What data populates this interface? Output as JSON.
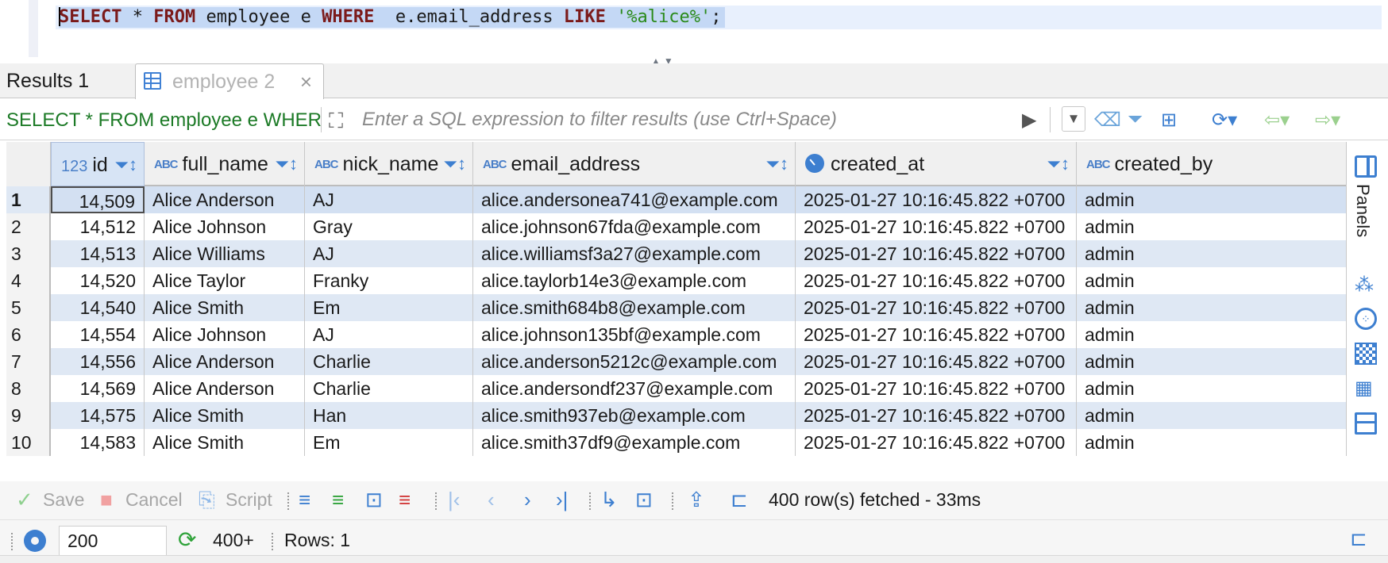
{
  "editor": {
    "sql_parts": [
      {
        "t": "SELECT",
        "c": "kw"
      },
      {
        "t": " * ",
        "c": "id"
      },
      {
        "t": "FROM",
        "c": "kw"
      },
      {
        "t": " employee e ",
        "c": "id"
      },
      {
        "t": "WHERE",
        "c": "kw"
      },
      {
        "t": "  e.email_address ",
        "c": "id"
      },
      {
        "t": "LIKE",
        "c": "kw"
      },
      {
        "t": " ",
        "c": "id"
      },
      {
        "t": "'%alice%'",
        "c": "str"
      },
      {
        "t": ";",
        "c": "id"
      }
    ],
    "splitter_arrows": "▲▼"
  },
  "tabs": {
    "results_label": "Results 1",
    "employee_label": "employee 2",
    "close_glyph": "×"
  },
  "filter": {
    "query_text": "SELECT * FROM employee e WHERE  e.email_address LIKE '%alice%'",
    "placeholder": "Enter a SQL expression to filter results (use Ctrl+Space)"
  },
  "grid": {
    "columns": [
      {
        "label": "id",
        "type": "123"
      },
      {
        "label": "full_name",
        "type": "ABC"
      },
      {
        "label": "nick_name",
        "type": "ABC"
      },
      {
        "label": "email_address",
        "type": "ABC"
      },
      {
        "label": "created_at",
        "type": "clock"
      },
      {
        "label": "created_by",
        "type": "ABC"
      }
    ],
    "rows": [
      [
        "1",
        "14,509",
        "Alice Anderson",
        "AJ",
        "alice.andersonea741@example.com",
        "2025-01-27 10:16:45.822 +0700",
        "admin"
      ],
      [
        "2",
        "14,512",
        "Alice Johnson",
        "Gray",
        "alice.johnson67fda@example.com",
        "2025-01-27 10:16:45.822 +0700",
        "admin"
      ],
      [
        "3",
        "14,513",
        "Alice Williams",
        "AJ",
        "alice.williamsf3a27@example.com",
        "2025-01-27 10:16:45.822 +0700",
        "admin"
      ],
      [
        "4",
        "14,520",
        "Alice Taylor",
        "Franky",
        "alice.taylorb14e3@example.com",
        "2025-01-27 10:16:45.822 +0700",
        "admin"
      ],
      [
        "5",
        "14,540",
        "Alice Smith",
        "Em",
        "alice.smith684b8@example.com",
        "2025-01-27 10:16:45.822 +0700",
        "admin"
      ],
      [
        "6",
        "14,554",
        "Alice Johnson",
        "AJ",
        "alice.johnson135bf@example.com",
        "2025-01-27 10:16:45.822 +0700",
        "admin"
      ],
      [
        "7",
        "14,556",
        "Alice Anderson",
        "Charlie",
        "alice.anderson5212c@example.com",
        "2025-01-27 10:16:45.822 +0700",
        "admin"
      ],
      [
        "8",
        "14,569",
        "Alice Anderson",
        "Charlie",
        "alice.andersondf237@example.com",
        "2025-01-27 10:16:45.822 +0700",
        "admin"
      ],
      [
        "9",
        "14,575",
        "Alice Smith",
        "Han",
        "alice.smith937eb@example.com",
        "2025-01-27 10:16:45.822 +0700",
        "admin"
      ],
      [
        "10",
        "14,583",
        "Alice Smith",
        "Em",
        "alice.smith37df9@example.com",
        "2025-01-27 10:16:45.822 +0700",
        "admin"
      ]
    ]
  },
  "side_panel": {
    "label": "Panels"
  },
  "toolbar": {
    "save_label": "Save",
    "cancel_label": "Cancel",
    "script_label": "Script",
    "status": "400 row(s) fetched - 33ms"
  },
  "statusbar": {
    "fetch_size": "200",
    "count_label": "400+",
    "rows_label": "Rows: 1"
  }
}
